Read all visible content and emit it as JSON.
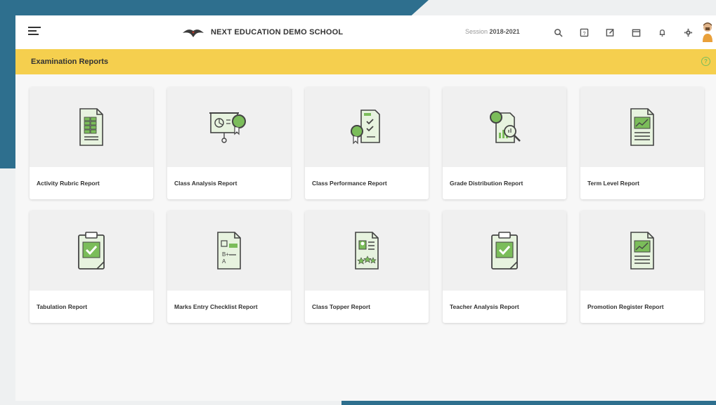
{
  "topbar": {
    "school_name": "NEXT EDUCATION DEMO SCHOOL",
    "session_label": "Session",
    "session_value": "2018-2021",
    "icons": [
      "search-icon",
      "help-doc-icon",
      "edit-icon",
      "calendar-icon",
      "bell-icon",
      "gear-icon",
      "avatar"
    ]
  },
  "subheader": {
    "title": "Examination Reports"
  },
  "cards": [
    {
      "label": "Activity Rubric Report",
      "icon": "document-grid-icon"
    },
    {
      "label": "Class Analysis Report",
      "icon": "presentation-badge-icon"
    },
    {
      "label": "Class Performance Report",
      "icon": "checklist-badge-icon"
    },
    {
      "label": "Grade Distribution Report",
      "icon": "chart-magnifier-icon"
    },
    {
      "label": "Term Level Report",
      "icon": "document-chart-icon"
    },
    {
      "label": "Tabulation Report",
      "icon": "clipboard-check-icon"
    },
    {
      "label": "Marks Entry Checklist Report",
      "icon": "document-grades-icon"
    },
    {
      "label": "Class Topper Report",
      "icon": "document-profile-icon"
    },
    {
      "label": "Teacher Analysis Report",
      "icon": "clipboard-check-icon"
    },
    {
      "label": "Promotion Register Report",
      "icon": "document-chart-icon"
    }
  ],
  "colors": {
    "accent_yellow": "#f5cf4e",
    "icon_green": "#7bbd5a",
    "frame_blue": "#2e6f8e"
  }
}
